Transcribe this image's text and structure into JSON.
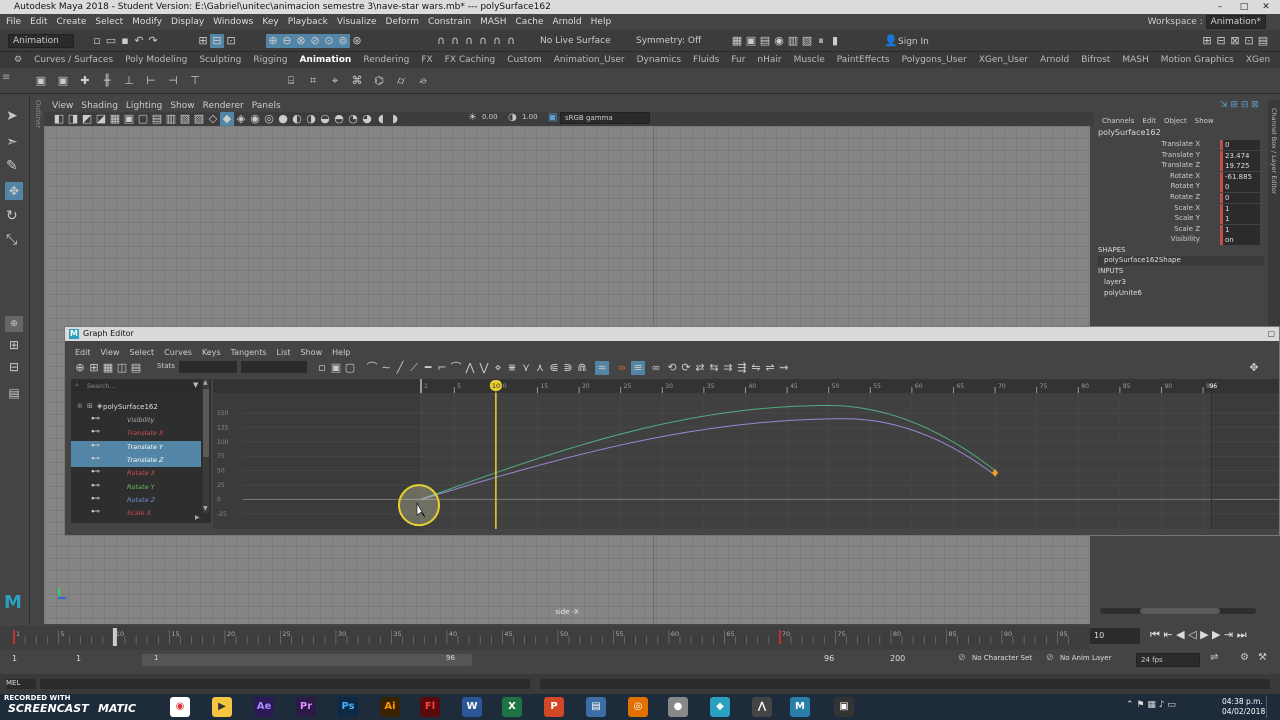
{
  "window": {
    "title": "Autodesk Maya 2018 - Student Version: E:\\Gabriel\\unitec\\animacion semestre 3\\nave-star wars.mb*   ---   polySurface162"
  },
  "menubar": {
    "items": [
      "File",
      "Edit",
      "Create",
      "Select",
      "Modify",
      "Display",
      "Windows",
      "Key",
      "Playback",
      "Visualize",
      "Deform",
      "Constrain",
      "MASH",
      "Cache",
      "Arnold",
      "Help"
    ],
    "workspace_label": "Workspace :",
    "workspace_value": "Animation*"
  },
  "statusline": {
    "mode": "Animation",
    "live_surface": "No Live Surface",
    "symmetry": "Symmetry: Off",
    "sign_in": "Sign In"
  },
  "shelf": {
    "tabs": [
      "Curves / Surfaces",
      "Poly Modeling",
      "Sculpting",
      "Rigging",
      "Animation",
      "Rendering",
      "FX",
      "FX Caching",
      "Custom",
      "Animation_User",
      "Dynamics",
      "Fluids",
      "Fur",
      "nHair",
      "Muscle",
      "PaintEffects",
      "Polygons_User",
      "XGen_User",
      "Arnold",
      "Bifrost",
      "MASH",
      "Motion Graphics",
      "XGen"
    ],
    "active_tab": "Animation"
  },
  "viewport": {
    "menu": [
      "View",
      "Shading",
      "Lighting",
      "Show",
      "Renderer",
      "Panels"
    ],
    "exposure": "0.00",
    "gamma": "1.00",
    "color_space": "sRGB gamma",
    "camera_label": "side -X"
  },
  "channel_box": {
    "menu": [
      "Channels",
      "Edit",
      "Object",
      "Show"
    ],
    "object": "polySurface162",
    "channels": [
      {
        "name": "Translate X",
        "value": "0"
      },
      {
        "name": "Translate Y",
        "value": "23.474"
      },
      {
        "name": "Translate Z",
        "value": "19.725"
      },
      {
        "name": "Rotate X",
        "value": "-61.885"
      },
      {
        "name": "Rotate Y",
        "value": "0"
      },
      {
        "name": "Rotate Z",
        "value": "0"
      },
      {
        "name": "Scale X",
        "value": "1"
      },
      {
        "name": "Scale Y",
        "value": "1"
      },
      {
        "name": "Scale Z",
        "value": "1"
      },
      {
        "name": "Visibility",
        "value": "on"
      }
    ],
    "shapes_header": "SHAPES",
    "shape": "polySurface162Shape",
    "inputs_header": "INPUTS",
    "inputs": [
      "layer3",
      "polyUnite6"
    ],
    "side_tabs": "Channel Box / Layer Editor"
  },
  "graph_editor": {
    "title": "Graph Editor",
    "menu": [
      "Edit",
      "View",
      "Select",
      "Curves",
      "Keys",
      "Tangents",
      "List",
      "Show",
      "Help"
    ],
    "stats_label": "Stats",
    "search_placeholder": "Search...",
    "outliner": {
      "root": "polySurface162",
      "attributes": [
        {
          "name": "Visibility",
          "color": "#b0b0b0",
          "selected": false
        },
        {
          "name": "Translate X",
          "color": "#d05050",
          "selected": false
        },
        {
          "name": "Translate Y",
          "color": "#ffffff",
          "selected": true
        },
        {
          "name": "Translate Z",
          "color": "#ffffff",
          "selected": true
        },
        {
          "name": "Rotate X",
          "color": "#d05050",
          "selected": false
        },
        {
          "name": "Rotate Y",
          "color": "#60c060",
          "selected": false
        },
        {
          "name": "Rotate Z",
          "color": "#7090d0",
          "selected": false
        },
        {
          "name": "Scale X",
          "color": "#d05050",
          "selected": false
        }
      ]
    },
    "x_ticks": [
      "1",
      "5",
      "10",
      "15",
      "20",
      "25",
      "30",
      "35",
      "40",
      "45",
      "50",
      "55",
      "60",
      "65",
      "70",
      "75",
      "80",
      "85",
      "90",
      "95"
    ],
    "y_ticks": [
      "150",
      "125",
      "100",
      "75",
      "50",
      "25",
      "0",
      "-25"
    ],
    "current_frame": "10",
    "end_marker": "96"
  },
  "timeline": {
    "ticks": [
      "1",
      "5",
      "10",
      "15",
      "20",
      "25",
      "30",
      "35",
      "40",
      "45",
      "50",
      "55",
      "60",
      "65",
      "70",
      "75",
      "80",
      "85",
      "90",
      "95"
    ],
    "current_frame_field": "10",
    "range_start": "1",
    "range_start2": "1",
    "range_inner_start": "1",
    "range_inner_end": "96",
    "range_end": "96",
    "range_end2": "200",
    "character_set": "No Character Set",
    "anim_layer": "No Anim Layer",
    "fps": "24 fps"
  },
  "taskbar": {
    "watermark_1": "RECORDED WITH",
    "watermark_2": "SCREENCAST",
    "watermark_3": "MATIC",
    "time": "04:38 p.m.",
    "date": "04/02/2018"
  }
}
